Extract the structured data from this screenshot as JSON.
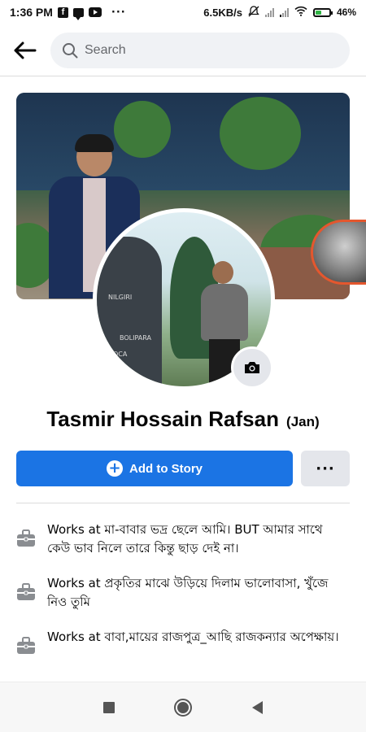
{
  "status_bar": {
    "time": "1:36 PM",
    "network_speed": "6.5KB/s",
    "battery_percent": "46",
    "battery_level": 0.46,
    "overflow": "···"
  },
  "search": {
    "placeholder": "Search"
  },
  "profile": {
    "name": "Tasmir Hossain Rafsan",
    "alternate_name": "(Jan)"
  },
  "actions": {
    "add_story_label": "Add to Story",
    "more_label": "···"
  },
  "work_items": [
    {
      "text": "Works at মা-বাবার ভদ্র ছেলে আমি। BUT আমার সাথে কেউ ভাব নিলে তারে কিন্তু ছাড় দেই না।"
    },
    {
      "text": "Works at প্রকৃতির মাঝে উড়িয়ে দিলাম ভালোবাসা, খুঁজে নিও তুমি"
    },
    {
      "text": "Works at বাবা,মায়ের রাজপুত্র_আছি রাজকন্যার অপেক্ষায়।"
    }
  ],
  "profile_photo_text": [
    "NILGIRI",
    "BOLIPARA",
    "OCA"
  ],
  "colors": {
    "primary": "#1b74e4",
    "secondary_button": "#e4e6eb",
    "search_bg": "#f0f2f5"
  }
}
